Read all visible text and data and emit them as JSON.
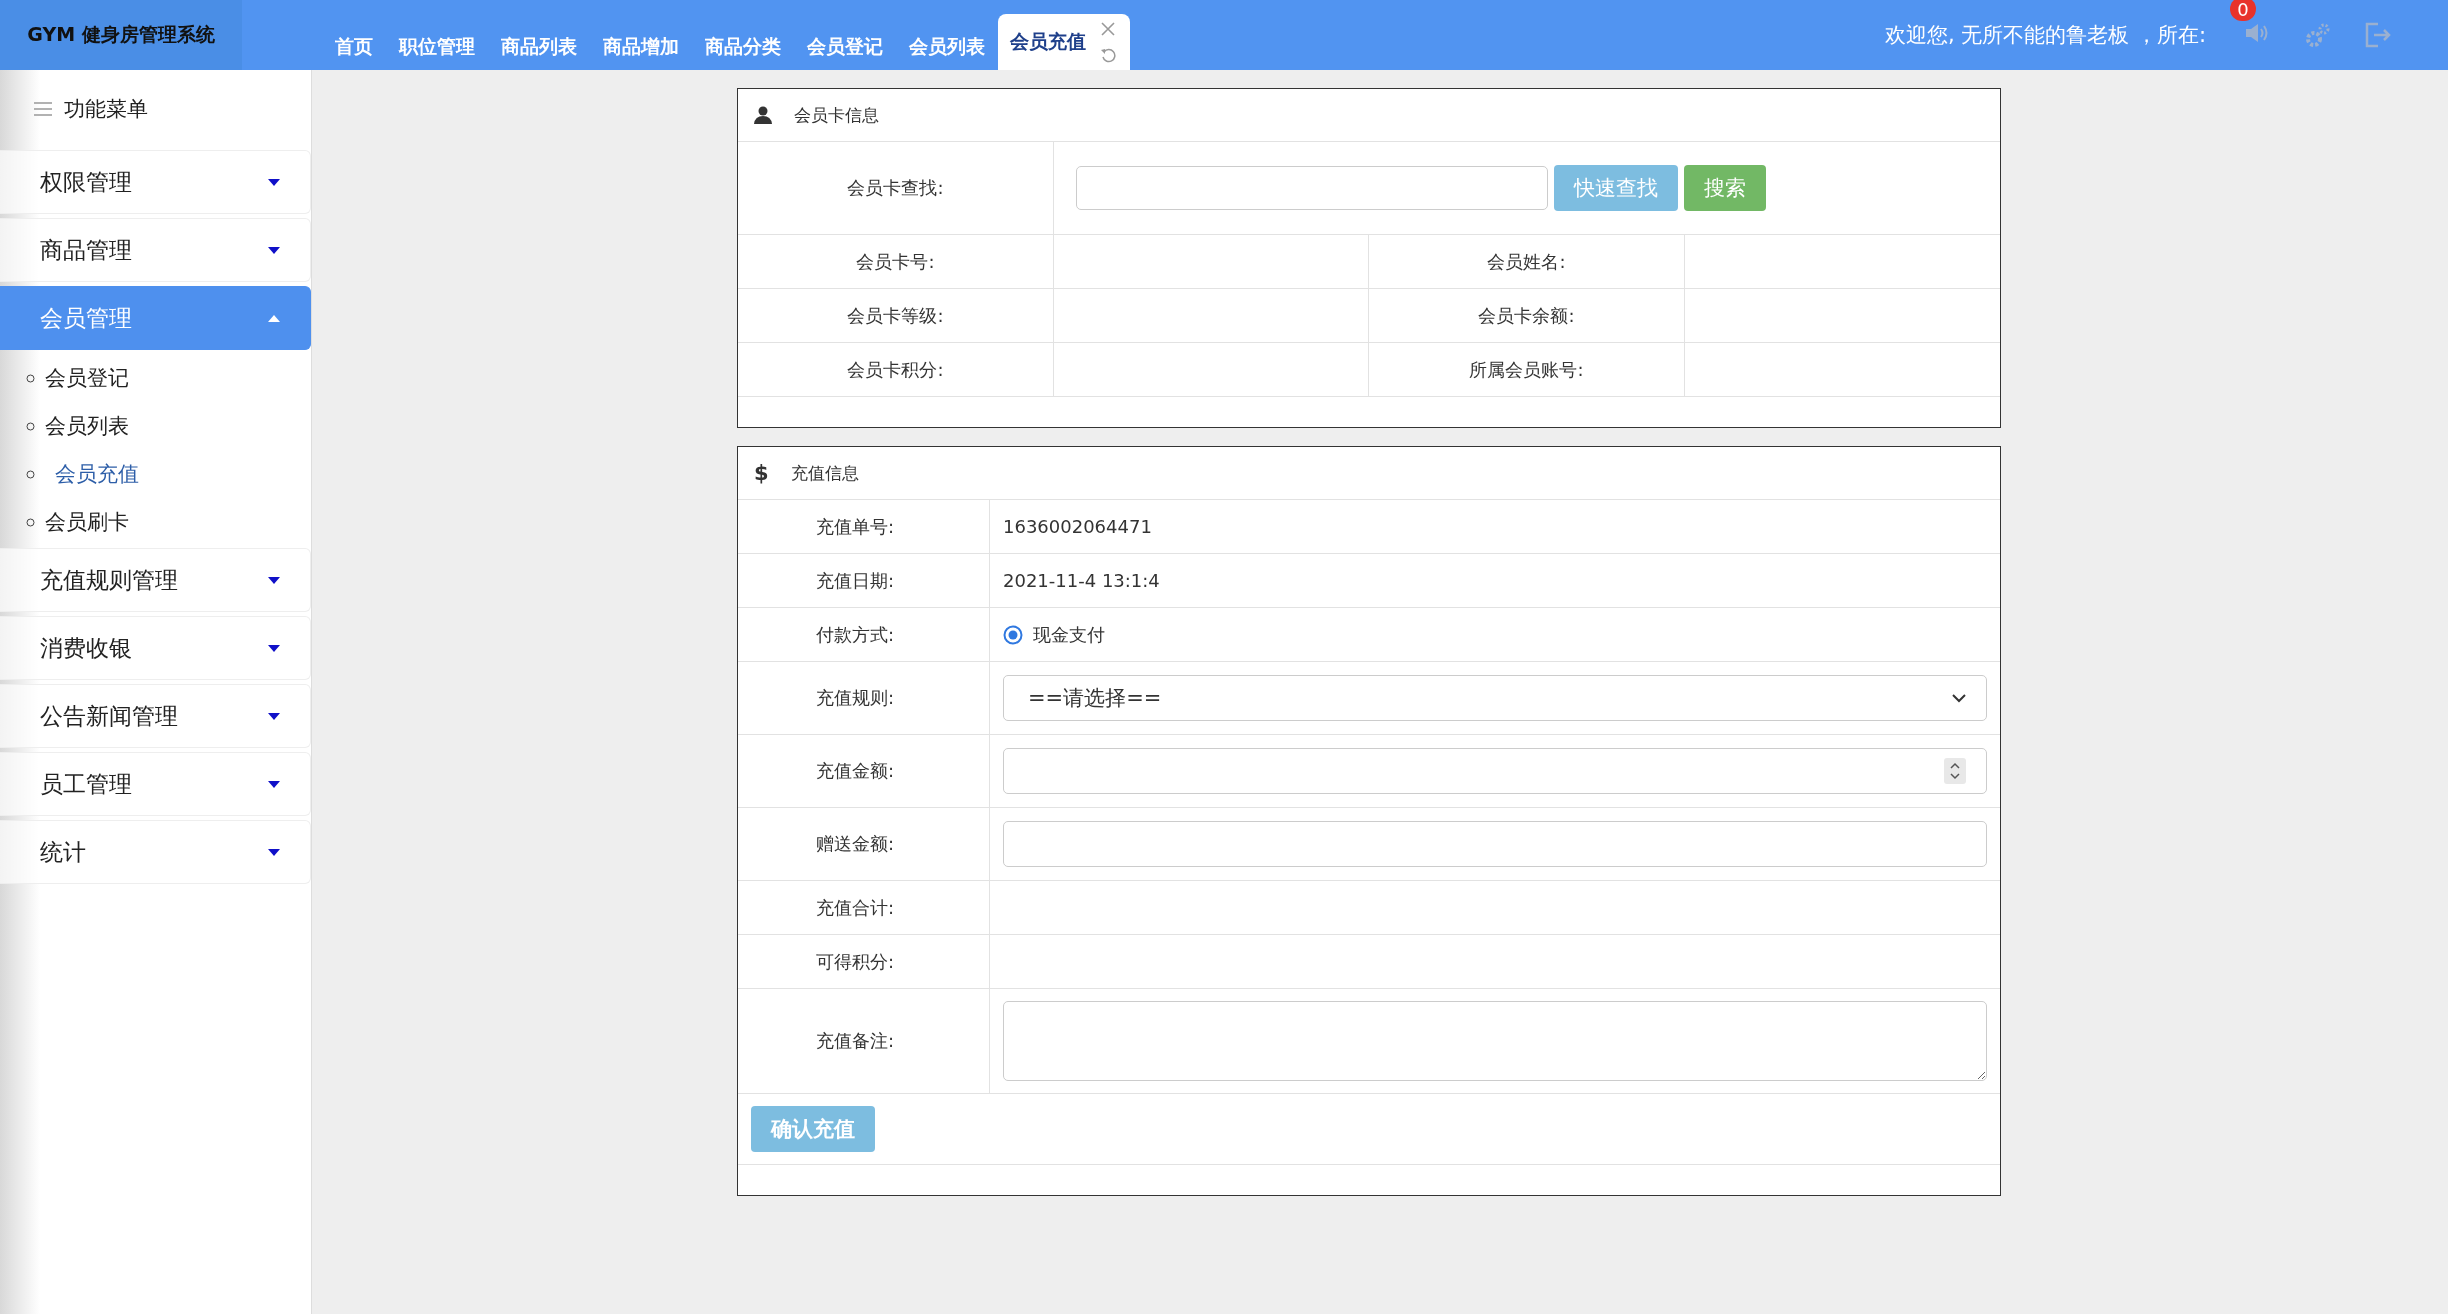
{
  "header": {
    "logo": "GYM 健身房管理系统",
    "tabs": [
      {
        "label": "首页",
        "selected": false
      },
      {
        "label": "职位管理",
        "selected": false
      },
      {
        "label": "商品列表",
        "selected": false
      },
      {
        "label": "商品增加",
        "selected": false
      },
      {
        "label": "商品分类",
        "selected": false
      },
      {
        "label": "会员登记",
        "selected": false
      },
      {
        "label": "会员列表",
        "selected": false
      },
      {
        "label": "会员充值",
        "selected": true
      }
    ],
    "welcome": "欢迎您, 无所不能的鲁老板 ，所在:",
    "notification_count": "0"
  },
  "sidebar": {
    "title": "功能菜单",
    "groups": [
      {
        "label": "权限管理",
        "expanded": false
      },
      {
        "label": "商品管理",
        "expanded": false
      },
      {
        "label": "会员管理",
        "expanded": true,
        "children": [
          {
            "label": "会员登记",
            "selected": false
          },
          {
            "label": "会员列表",
            "selected": false
          },
          {
            "label": "会员充值",
            "selected": true
          },
          {
            "label": "会员刷卡",
            "selected": false
          }
        ]
      },
      {
        "label": "充值规则管理",
        "expanded": false
      },
      {
        "label": "消费收银",
        "expanded": false
      },
      {
        "label": "公告新闻管理",
        "expanded": false
      },
      {
        "label": "员工管理",
        "expanded": false
      },
      {
        "label": "统计",
        "expanded": false
      }
    ]
  },
  "card_panel": {
    "title": "会员卡信息",
    "search_label": "会员卡查找:",
    "buttons": [
      {
        "label": "快速查找",
        "kind": "info"
      },
      {
        "label": "搜索",
        "kind": "success"
      }
    ],
    "fields": [
      [
        "会员卡号:",
        "会员姓名:"
      ],
      [
        "会员卡等级:",
        "会员卡余额:"
      ],
      [
        "会员卡积分:",
        "所属会员账号:"
      ]
    ]
  },
  "recharge_panel": {
    "title_icon": "$",
    "title": "充值信息",
    "rows": [
      {
        "kind": "text",
        "label": "充值单号:",
        "value": "1636002064471"
      },
      {
        "kind": "text",
        "label": "充值日期:",
        "value": "2021-11-4 13:1:4"
      },
      {
        "kind": "radio",
        "label": "付款方式:",
        "options": [
          {
            "label": "现金支付",
            "selected": true
          }
        ]
      },
      {
        "kind": "select",
        "label": "充值规则:",
        "value": "==请选择=="
      },
      {
        "kind": "number",
        "label": "充值金额:"
      },
      {
        "kind": "input",
        "label": "赠送金额:"
      },
      {
        "kind": "text",
        "label": "充值合计:"
      },
      {
        "kind": "text",
        "label": "可得积分:"
      },
      {
        "kind": "textarea",
        "label": "充值备注:"
      }
    ],
    "submit": "确认充值"
  }
}
